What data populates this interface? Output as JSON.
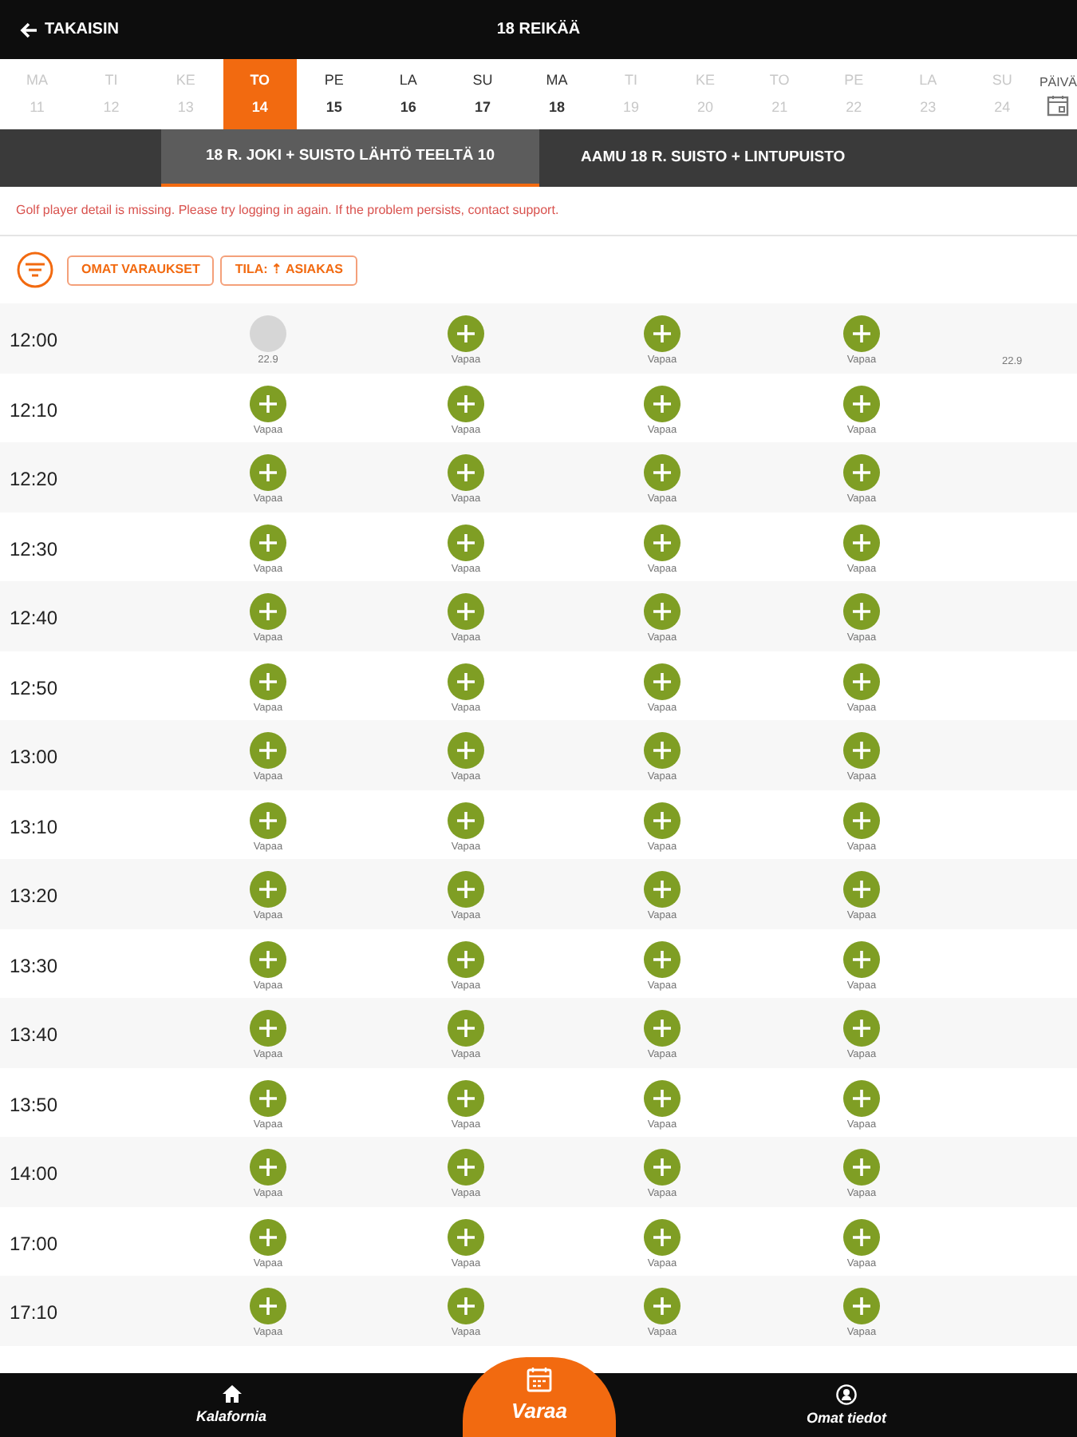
{
  "header": {
    "back": "TAKAISIN",
    "title": "18 REIKÄÄ"
  },
  "days": [
    {
      "weekday": "MA",
      "date": "11",
      "selected": false,
      "disabled": true
    },
    {
      "weekday": "TI",
      "date": "12",
      "selected": false,
      "disabled": true
    },
    {
      "weekday": "KE",
      "date": "13",
      "selected": false,
      "disabled": true
    },
    {
      "weekday": "TO",
      "date": "14",
      "selected": true,
      "disabled": false
    },
    {
      "weekday": "PE",
      "date": "15",
      "selected": false,
      "disabled": false
    },
    {
      "weekday": "LA",
      "date": "16",
      "selected": false,
      "disabled": false
    },
    {
      "weekday": "SU",
      "date": "17",
      "selected": false,
      "disabled": false
    },
    {
      "weekday": "MA",
      "date": "18",
      "selected": false,
      "disabled": false
    },
    {
      "weekday": "TI",
      "date": "19",
      "selected": false,
      "disabled": true
    },
    {
      "weekday": "KE",
      "date": "20",
      "selected": false,
      "disabled": true
    },
    {
      "weekday": "TO",
      "date": "21",
      "selected": false,
      "disabled": true
    },
    {
      "weekday": "PE",
      "date": "22",
      "selected": false,
      "disabled": true
    },
    {
      "weekday": "LA",
      "date": "23",
      "selected": false,
      "disabled": true
    },
    {
      "weekday": "SU",
      "date": "24",
      "selected": false,
      "disabled": true
    }
  ],
  "day_picker": "PÄIVÄ",
  "course_tabs": [
    {
      "label": "18 R. JOKI + SUISTO LÄHTÖ TEELTÄ 10",
      "selected": true
    },
    {
      "label": "AAMU 18 R. SUISTO + LINTUPUISTO",
      "selected": false
    }
  ],
  "error": "Golf player detail is missing. Please try logging in again. If the problem persists, contact support.",
  "filters": [
    "OMAT VARAUKSET",
    "TILA: ⇡ ASIAKAS"
  ],
  "rows": [
    {
      "time": "12:00",
      "slots": [
        {
          "kind": "taken",
          "label": "22.9"
        },
        {
          "kind": "free",
          "label": "Vapaa"
        },
        {
          "kind": "free",
          "label": "Vapaa"
        },
        {
          "kind": "free",
          "label": "Vapaa"
        }
      ],
      "note": "22.9"
    },
    {
      "time": "12:10",
      "slots": [
        {
          "kind": "free",
          "label": "Vapaa"
        },
        {
          "kind": "free",
          "label": "Vapaa"
        },
        {
          "kind": "free",
          "label": "Vapaa"
        },
        {
          "kind": "free",
          "label": "Vapaa"
        }
      ]
    },
    {
      "time": "12:20",
      "slots": [
        {
          "kind": "free",
          "label": "Vapaa"
        },
        {
          "kind": "free",
          "label": "Vapaa"
        },
        {
          "kind": "free",
          "label": "Vapaa"
        },
        {
          "kind": "free",
          "label": "Vapaa"
        }
      ]
    },
    {
      "time": "12:30",
      "slots": [
        {
          "kind": "free",
          "label": "Vapaa"
        },
        {
          "kind": "free",
          "label": "Vapaa"
        },
        {
          "kind": "free",
          "label": "Vapaa"
        },
        {
          "kind": "free",
          "label": "Vapaa"
        }
      ]
    },
    {
      "time": "12:40",
      "slots": [
        {
          "kind": "free",
          "label": "Vapaa"
        },
        {
          "kind": "free",
          "label": "Vapaa"
        },
        {
          "kind": "free",
          "label": "Vapaa"
        },
        {
          "kind": "free",
          "label": "Vapaa"
        }
      ]
    },
    {
      "time": "12:50",
      "slots": [
        {
          "kind": "free",
          "label": "Vapaa"
        },
        {
          "kind": "free",
          "label": "Vapaa"
        },
        {
          "kind": "free",
          "label": "Vapaa"
        },
        {
          "kind": "free",
          "label": "Vapaa"
        }
      ]
    },
    {
      "time": "13:00",
      "slots": [
        {
          "kind": "free",
          "label": "Vapaa"
        },
        {
          "kind": "free",
          "label": "Vapaa"
        },
        {
          "kind": "free",
          "label": "Vapaa"
        },
        {
          "kind": "free",
          "label": "Vapaa"
        }
      ]
    },
    {
      "time": "13:10",
      "slots": [
        {
          "kind": "free",
          "label": "Vapaa"
        },
        {
          "kind": "free",
          "label": "Vapaa"
        },
        {
          "kind": "free",
          "label": "Vapaa"
        },
        {
          "kind": "free",
          "label": "Vapaa"
        }
      ]
    },
    {
      "time": "13:20",
      "slots": [
        {
          "kind": "free",
          "label": "Vapaa"
        },
        {
          "kind": "free",
          "label": "Vapaa"
        },
        {
          "kind": "free",
          "label": "Vapaa"
        },
        {
          "kind": "free",
          "label": "Vapaa"
        }
      ]
    },
    {
      "time": "13:30",
      "slots": [
        {
          "kind": "free",
          "label": "Vapaa"
        },
        {
          "kind": "free",
          "label": "Vapaa"
        },
        {
          "kind": "free",
          "label": "Vapaa"
        },
        {
          "kind": "free",
          "label": "Vapaa"
        }
      ]
    },
    {
      "time": "13:40",
      "slots": [
        {
          "kind": "free",
          "label": "Vapaa"
        },
        {
          "kind": "free",
          "label": "Vapaa"
        },
        {
          "kind": "free",
          "label": "Vapaa"
        },
        {
          "kind": "free",
          "label": "Vapaa"
        }
      ]
    },
    {
      "time": "13:50",
      "slots": [
        {
          "kind": "free",
          "label": "Vapaa"
        },
        {
          "kind": "free",
          "label": "Vapaa"
        },
        {
          "kind": "free",
          "label": "Vapaa"
        },
        {
          "kind": "free",
          "label": "Vapaa"
        }
      ]
    },
    {
      "time": "14:00",
      "slots": [
        {
          "kind": "free",
          "label": "Vapaa"
        },
        {
          "kind": "free",
          "label": "Vapaa"
        },
        {
          "kind": "free",
          "label": "Vapaa"
        },
        {
          "kind": "free",
          "label": "Vapaa"
        }
      ]
    },
    {
      "time": "17:00",
      "slots": [
        {
          "kind": "free",
          "label": "Vapaa"
        },
        {
          "kind": "free",
          "label": "Vapaa"
        },
        {
          "kind": "free",
          "label": "Vapaa"
        },
        {
          "kind": "free",
          "label": "Vapaa"
        }
      ]
    },
    {
      "time": "17:10",
      "slots": [
        {
          "kind": "free",
          "label": "Vapaa"
        },
        {
          "kind": "free",
          "label": "Vapaa"
        },
        {
          "kind": "free",
          "label": "Vapaa"
        },
        {
          "kind": "free",
          "label": "Vapaa"
        }
      ]
    }
  ],
  "nav": [
    {
      "kind": "home",
      "label": "Kalafornia",
      "selected": false
    },
    {
      "kind": "calendar",
      "label": "Varaa",
      "selected": true
    },
    {
      "kind": "user",
      "label": "Omat tiedot",
      "selected": false
    }
  ]
}
